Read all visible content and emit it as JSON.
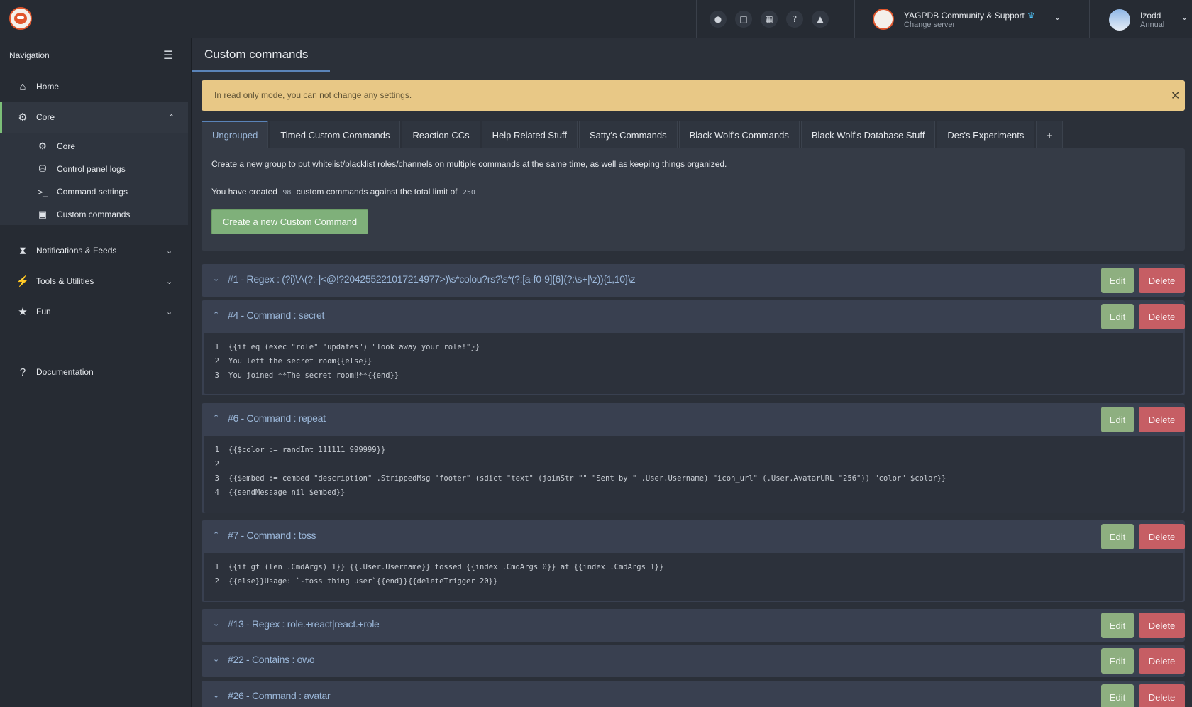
{
  "topbar": {
    "icons": [
      "lightbulb-icon",
      "chat-icon",
      "keyboard-icon",
      "help-icon",
      "warning-icon"
    ],
    "server_name": "YAGPDB Community & Support",
    "server_sub": "Change server",
    "user_name": "Izodd",
    "user_sub": "Annual"
  },
  "sidebar": {
    "title": "Navigation",
    "items": [
      {
        "label": "Home",
        "icon": "home-icon"
      },
      {
        "label": "Core",
        "icon": "gears-icon"
      },
      {
        "label": "Notifications & Feeds",
        "icon": "rss-icon"
      },
      {
        "label": "Tools & Utilities",
        "icon": "bolt-icon"
      },
      {
        "label": "Fun",
        "icon": "trophy-icon"
      },
      {
        "label": "Documentation",
        "icon": "question-icon"
      }
    ],
    "core_sub": [
      {
        "label": "Core",
        "icon": "gear-icon"
      },
      {
        "label": "Control panel logs",
        "icon": "database-icon"
      },
      {
        "label": "Command settings",
        "icon": "terminal-icon"
      },
      {
        "label": "Custom commands",
        "icon": "cc-icon"
      }
    ]
  },
  "main": {
    "title": "Custom commands",
    "alert": "In read only mode, you can not change any settings.",
    "tabs": [
      "Ungrouped",
      "Timed Custom Commands",
      "Reaction CCs",
      "Help Related Stuff",
      "Satty's Commands",
      "Black Wolf's Commands",
      "Black Wolf's Database Stuff",
      "Des's Experiments",
      "+"
    ],
    "info_line": "Create a new group to put whitelist/blacklist roles/channels on multiple commands at the same time, as well as keeping things organized.",
    "count_prefix": "You have created",
    "count_created": "98",
    "count_middle": "custom commands against the total limit of",
    "count_limit": "250",
    "create_button": "Create a new Custom Command",
    "edit_label": "Edit",
    "delete_label": "Delete"
  },
  "commands": [
    {
      "title": "#1 - Regex : (?i)\\A(?:-|<@!?204255221017214977>)\\s*colou?rs?\\s*(?:[a-f0-9]{6}(?:\\s+|\\z)){1,10}\\z",
      "expanded": false
    },
    {
      "title": "#4 - Command : secret",
      "expanded": true,
      "code": [
        "{{if eq (exec \"role\" \"updates\") \"Took away your role!\"}}",
        "You left the secret room{{else}}",
        "You joined **The secret room‼**{{end}}"
      ]
    },
    {
      "title": "#6 - Command : repeat",
      "expanded": true,
      "code": [
        "{{$color := randInt 111111 999999}}",
        "",
        "{{$embed := cembed \"description\" .StrippedMsg \"footer\" (sdict \"text\" (joinStr \"\" \"Sent by \" .User.Username) \"icon_url\" (.User.AvatarURL \"256\")) \"color\" $color}}",
        "{{sendMessage nil $embed}}"
      ]
    },
    {
      "title": "#7 - Command : toss",
      "expanded": true,
      "code": [
        "{{if gt (len .CmdArgs) 1}} {{.User.Username}} tossed {{index .CmdArgs 0}} at {{index .CmdArgs 1}}",
        "{{else}}Usage: `-toss thing user`{{end}}{{deleteTrigger 20}}"
      ]
    },
    {
      "title": "#13 - Regex : role.+react|react.+role",
      "expanded": false
    },
    {
      "title": "#22 - Contains : owo",
      "expanded": false
    },
    {
      "title": "#26 - Command : avatar",
      "expanded": false
    }
  ],
  "colors": {
    "accent": "#5a83b8",
    "edit": "#8eaf80",
    "delete": "#c65e64",
    "alert": "#e8c886",
    "create": "#7fb07a"
  }
}
